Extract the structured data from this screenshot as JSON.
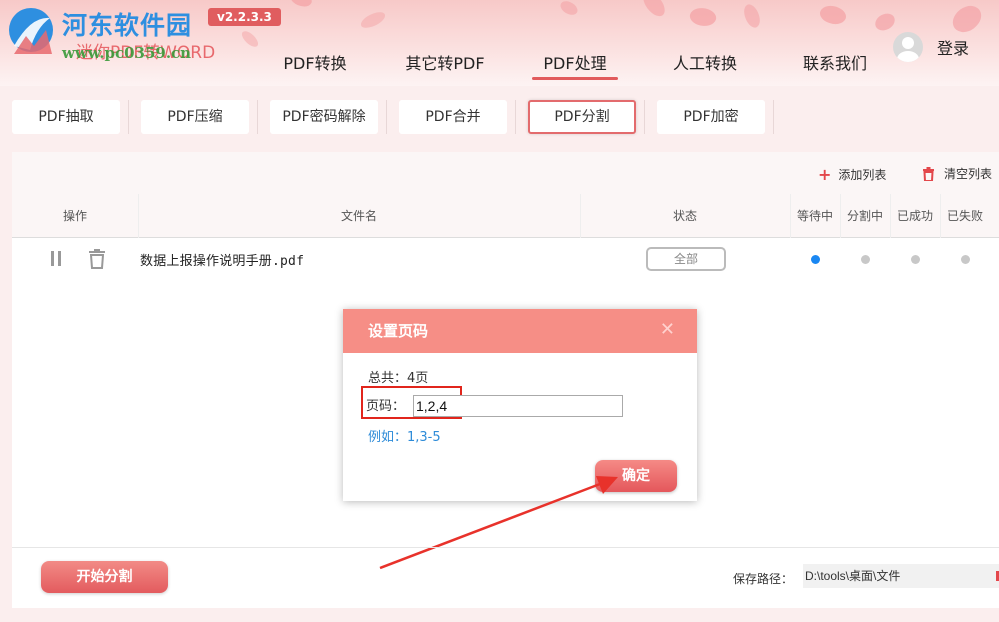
{
  "header": {
    "brand_title": "河东软件园",
    "brand_subtitle": "迷你PDF转WORD",
    "brand_url": "www.pc0359.cn",
    "version": "v2.2.3.3",
    "nav": [
      "PDF转换",
      "其它转PDF",
      "PDF处理",
      "人工转换",
      "联系我们"
    ],
    "nav_active": "PDF处理",
    "login": "登录"
  },
  "tabs": [
    "PDF抽取",
    "PDF压缩",
    "PDF密码解除",
    "PDF合并",
    "PDF分割",
    "PDF加密"
  ],
  "tab_active": "PDF分割",
  "toolbar": {
    "add": "添加列表",
    "clear": "清空列表"
  },
  "table": {
    "headers": {
      "op": "操作",
      "name": "文件名",
      "status": "状态",
      "waiting": "等待中",
      "splitting": "分割中",
      "success": "已成功",
      "failed": "已失败"
    },
    "rows": [
      {
        "file": "数据上报操作说明手册.pdf",
        "status": "全部"
      }
    ]
  },
  "dialog": {
    "title": "设置页码",
    "close": "✕",
    "total": "总共：4页",
    "page_label": "页码：",
    "page_value": "1,2,4",
    "example": "例如：1,3-5",
    "confirm": "确定"
  },
  "footer": {
    "start": "开始分割",
    "save_label": "保存路径：",
    "save_path": "D:\\tools\\桌面\\文件"
  },
  "colors": {
    "accent": "#e35b5e",
    "dialog_header": "#f68e86",
    "link": "#2d8bd8",
    "active_dot": "#1a87f2",
    "highlight": "#e1251c"
  }
}
